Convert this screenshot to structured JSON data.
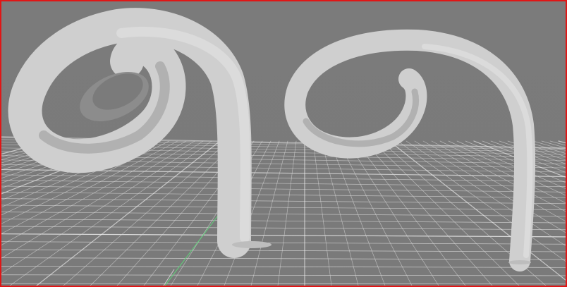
{
  "viewport": {
    "active_border_color": "#e01616",
    "background_color": "#7a7a7a",
    "grid_color": "#d9d9d9",
    "grid_major_color": "#f0f0f0",
    "axis_x_color": "#c8c8c8",
    "axis_y_color": "#5fd47a"
  },
  "scene": {
    "objects": [
      {
        "name": "curled-tube-thick",
        "surface_color": "#d0d0d0"
      },
      {
        "name": "curled-tube-thin",
        "surface_color": "#d0d0d0"
      }
    ]
  }
}
